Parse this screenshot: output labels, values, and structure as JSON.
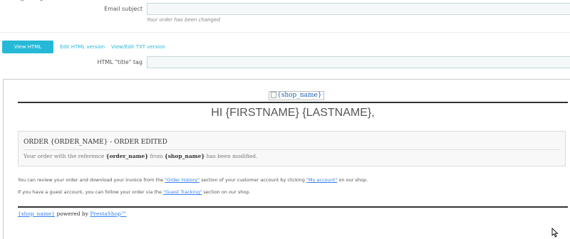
{
  "top_label": "order_changed",
  "subject": {
    "label": "Email subject",
    "value": "",
    "hint": "Your order has been changed"
  },
  "tabs": [
    {
      "label": "View HTML version",
      "active": true
    },
    {
      "label": "Edit HTML version",
      "active": false
    },
    {
      "label": "View/Edit TXT version",
      "active": false
    }
  ],
  "title_tag": {
    "label": "HTML \"title\" tag",
    "value": ""
  },
  "preview": {
    "logo_alt": "{shop_name}",
    "greeting": "HI {FIRSTNAME} {LASTNAME},",
    "box_title": "ORDER {ORDER_NAME} - ORDER EDITED",
    "box_text_1": "Your order with the reference ",
    "box_ref": "{order_name}",
    "box_text_2": " from ",
    "box_shop": "{shop_name}",
    "box_text_3": " has been modified.",
    "p1_a": "You can review your order and download your invoice from the ",
    "p1_link1": "\"Order history\"",
    "p1_b": " section of your customer account by clicking ",
    "p1_link2": "\"My account\"",
    "p1_c": " on our shop.",
    "p2_a": "If you have a guest account, you can follow your order via the ",
    "p2_link": "\"Guest Tracking\"",
    "p2_b": " section on our shop.",
    "footer_shop": "{shop_name}",
    "footer_text": " powered by ",
    "footer_link": "PrestaShop™"
  }
}
